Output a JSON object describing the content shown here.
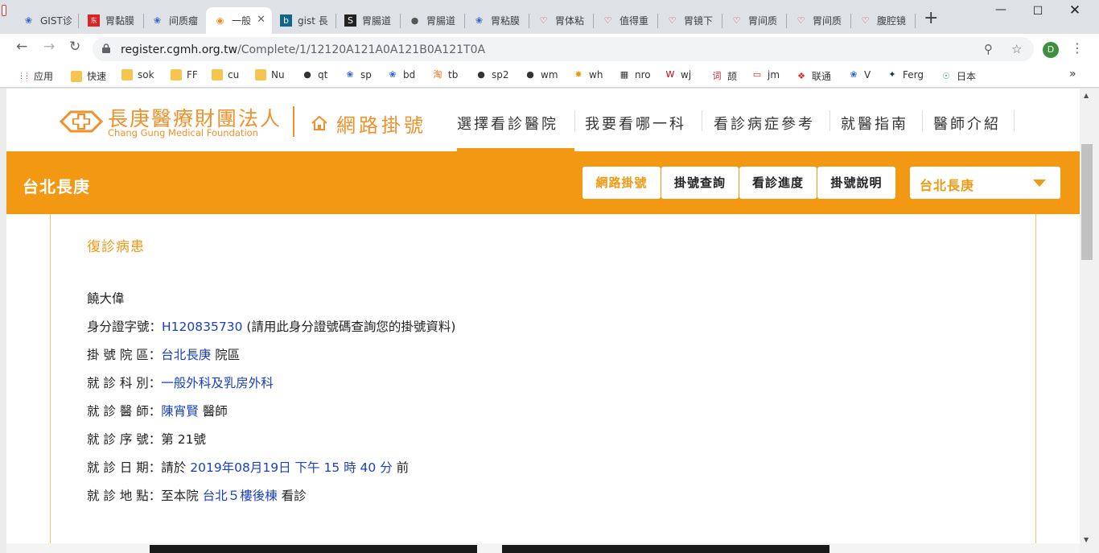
{
  "browser": {
    "tabs": [
      {
        "label": "GIST诊",
        "icon": "paw-icon",
        "color": "#2b5fdb"
      },
      {
        "label": "胃黏膜",
        "icon": "dongfang-icon",
        "color": "#d22"
      },
      {
        "label": "间质瘤",
        "icon": "paw-icon",
        "color": "#2b5fdb"
      },
      {
        "label": "一般",
        "icon": "eye-icon",
        "color": "#f0902a"
      },
      {
        "label": "gist 長",
        "icon": "bing-icon",
        "color": "#138"
      },
      {
        "label": "胃腸道",
        "icon": "s-icon",
        "color": "#222"
      },
      {
        "label": "胃腸道",
        "icon": "globe-icon",
        "color": "#555"
      },
      {
        "label": "胃粘膜",
        "icon": "paw-icon",
        "color": "#2b5fdb"
      },
      {
        "label": "胃体粘",
        "icon": "heart-icon",
        "color": "#d33"
      },
      {
        "label": "值得重",
        "icon": "heart-icon",
        "color": "#d33"
      },
      {
        "label": "胃镜下",
        "icon": "heart-icon",
        "color": "#d33"
      },
      {
        "label": "胃间质",
        "icon": "heart-icon",
        "color": "#d33"
      },
      {
        "label": "胃间质",
        "icon": "heart-icon",
        "color": "#d33"
      },
      {
        "label": "腹腔镜",
        "icon": "heart-icon",
        "color": "#d33"
      }
    ],
    "url_host": "register.cgmh.org.tw",
    "url_path": "/Complete/1/12120A121A0A121B0A121T0A",
    "profile_initial": "D",
    "bookmarks": [
      {
        "label": "应用",
        "icon": "apps-grid-icon"
      },
      {
        "label": "快速",
        "icon": "folder-icon"
      },
      {
        "label": "sok",
        "icon": "folder-icon"
      },
      {
        "label": "FF",
        "icon": "folder-icon"
      },
      {
        "label": "cu",
        "icon": "folder-icon"
      },
      {
        "label": "Nu",
        "icon": "folder-icon"
      },
      {
        "label": "qt",
        "icon": "globe-icon"
      },
      {
        "label": "sp",
        "icon": "paw-icon"
      },
      {
        "label": "bd",
        "icon": "paw-icon"
      },
      {
        "label": "tb",
        "icon": "taobao-icon"
      },
      {
        "label": "sp2",
        "icon": "globe-icon"
      },
      {
        "label": "wm",
        "icon": "globe-icon"
      },
      {
        "label": "wh",
        "icon": "pinwheel-icon"
      },
      {
        "label": "nro",
        "icon": "tv-icon"
      },
      {
        "label": "wj",
        "icon": "w-icon"
      },
      {
        "label": "颉",
        "icon": "ci-icon"
      },
      {
        "label": "jm",
        "icon": "jm-icon"
      },
      {
        "label": "联通",
        "icon": "unicom-icon"
      },
      {
        "label": "V",
        "icon": "paw-icon"
      },
      {
        "label": "Ferg",
        "icon": "ferg-icon"
      },
      {
        "label": "日本",
        "icon": "chrome-icon"
      }
    ]
  },
  "site": {
    "brand_zh": "長庚醫療財團法人",
    "brand_en": "Chang Gung Medical Foundation",
    "reg_title": "網路掛號",
    "nav": [
      "選擇看診醫院",
      "我要看哪一科",
      "看診病症參考",
      "就醫指南",
      "醫師介紹"
    ],
    "branch_name": "台北長庚",
    "subnav": [
      "網路掛號",
      "掛號查詢",
      "看診進度",
      "掛號說明"
    ],
    "branch_select": "台北長庚",
    "accent_color": "#f39812"
  },
  "result": {
    "title": "復診病患",
    "patient_name": "饒大偉",
    "id_label": "身分證字號：",
    "id_value": "H120835730",
    "id_note": "(請用此身分證號碼查詢您的掛號資料)",
    "hospital_label": "掛 號 院 區：",
    "hospital_value": "台北長庚",
    "hospital_suffix": " 院區",
    "dept_label": "就 診 科 別：",
    "dept_value": "一般外科及乳房外科",
    "doctor_label": "就 診 醫 師：",
    "doctor_value": "陳宵賢",
    "doctor_suffix": " 醫師",
    "seq_label": "就 診 序 號：",
    "seq_value": "第 21號",
    "date_label": "就 診 日 期：",
    "date_prefix": "請於 ",
    "date_value": "2019年08月19日 下午 15 時 40 分",
    "date_suffix": " 前",
    "loc_label": "就 診 地 點：",
    "loc_prefix": "至本院 ",
    "loc_value": "台北５樓後棟",
    "loc_suffix": " 看診"
  }
}
